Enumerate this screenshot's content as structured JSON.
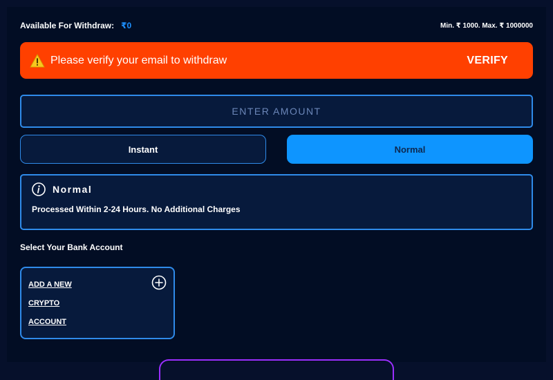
{
  "withdraw": {
    "available_label": "Available For Withdraw:",
    "available_amount": "₹0",
    "limits": "Min. ₹ 1000. Max. ₹ 1000000"
  },
  "banner": {
    "icon": "warning-icon",
    "message": "Please verify your email to withdraw",
    "action_label": "VERIFY",
    "color": "#ff4000"
  },
  "amount": {
    "placeholder": "ENTER AMOUNT",
    "value": ""
  },
  "modes": {
    "instant_label": "Instant",
    "normal_label": "Normal",
    "selected": "Normal"
  },
  "info": {
    "icon": "info-icon",
    "title": "Normal",
    "description": "Processed Within 2-24 Hours. No Additional Charges"
  },
  "bank": {
    "section_label": "Select Your Bank Account",
    "add_new_lines": [
      "ADD A NEW",
      "CRYPTO",
      "ACCOUNT"
    ],
    "add_icon": "plus-circle-icon"
  },
  "colors": {
    "accent": "#2f8bea",
    "selected_button": "#0e95ff",
    "background": "#020d24",
    "highlight_amount": "#1e90ff",
    "bottom_button_border": "#9b2fff"
  }
}
